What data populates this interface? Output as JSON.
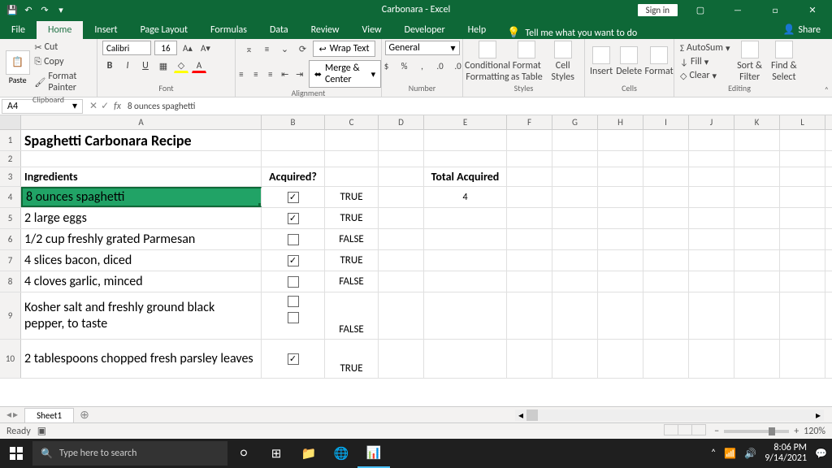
{
  "title": "Carbonara - Excel",
  "signin": "Sign in",
  "tabs": {
    "file": "File",
    "home": "Home",
    "insert": "Insert",
    "pagelayout": "Page Layout",
    "formulas": "Formulas",
    "data": "Data",
    "review": "Review",
    "view": "View",
    "developer": "Developer",
    "help": "Help"
  },
  "tell": "Tell me what you want to do",
  "share": "Share",
  "ribbon": {
    "clipboard": {
      "paste": "Paste",
      "cut": "Cut",
      "copy": "Copy",
      "painter": "Format Painter",
      "label": "Clipboard"
    },
    "font": {
      "name": "Calibri",
      "size": "16",
      "label": "Font"
    },
    "alignment": {
      "wrap": "Wrap Text",
      "merge": "Merge & Center",
      "label": "Alignment"
    },
    "number": {
      "general": "General",
      "label": "Number"
    },
    "styles": {
      "cond": "Conditional Formatting",
      "table": "Format as Table",
      "cell": "Cell Styles",
      "label": "Styles"
    },
    "cells": {
      "insert": "Insert",
      "delete": "Delete",
      "format": "Format",
      "label": "Cells"
    },
    "editing": {
      "sum": "AutoSum",
      "fill": "Fill",
      "clear": "Clear",
      "sort": "Sort & Filter",
      "find": "Find & Select",
      "label": "Editing"
    }
  },
  "namebox": "A4",
  "formula": "8 ounces spaghetti",
  "cols": [
    "A",
    "B",
    "C",
    "D",
    "E",
    "F",
    "G",
    "H",
    "I",
    "J",
    "K",
    "L"
  ],
  "cells": {
    "a1": "Spaghetti Carbonara Recipe",
    "a3": "Ingredients",
    "b3": "Acquired?",
    "e3": "Total Acquired",
    "a4": "8 ounces spaghetti",
    "c4": "TRUE",
    "e4": "4",
    "a5": "2 large eggs",
    "c5": "TRUE",
    "a6": "1/2 cup freshly grated Parmesan",
    "c6": "FALSE",
    "a7": "4 slices bacon, diced",
    "c7": "TRUE",
    "a8": "4 cloves garlic, minced",
    "c8": "FALSE",
    "a9": "Kosher salt and freshly ground black pepper, to taste",
    "c9": "FALSE",
    "a10": "2 tablespoons chopped fresh parsley leaves",
    "c10": "TRUE"
  },
  "sheet": "Sheet1",
  "status": "Ready",
  "zoom": "120%",
  "search": "Type here to search",
  "clock": {
    "time": "8:06 PM",
    "date": "9/14/2021"
  }
}
